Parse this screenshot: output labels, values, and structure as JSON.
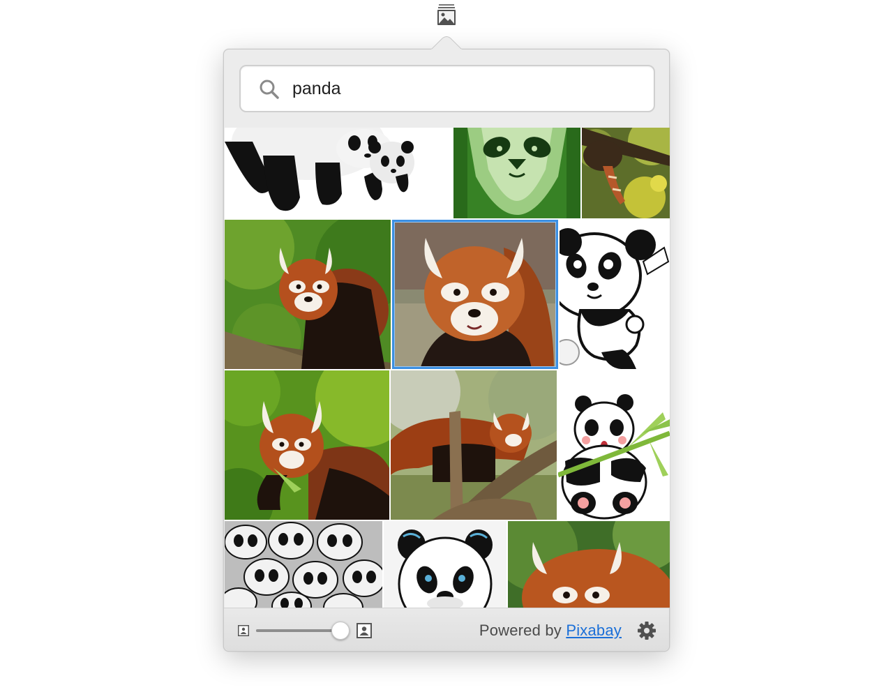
{
  "menubar": {
    "icon": "image-stack-icon"
  },
  "search": {
    "value": "panda",
    "icon": "search-icon"
  },
  "results": {
    "selected_index": 4,
    "images": [
      {
        "id": "cartoon-pandas-3d",
        "style": "3d-cartoon"
      },
      {
        "id": "panda-green-illustration",
        "style": "illustration"
      },
      {
        "id": "red-panda-in-tree",
        "style": "photo"
      },
      {
        "id": "red-panda-on-branch",
        "style": "photo"
      },
      {
        "id": "red-panda-portrait",
        "style": "photo"
      },
      {
        "id": "cartoon-panda-waving",
        "style": "cartoon"
      },
      {
        "id": "red-panda-eating-bamboo",
        "style": "photo"
      },
      {
        "id": "red-panda-climbing-log",
        "style": "photo"
      },
      {
        "id": "cartoon-panda-bamboo",
        "style": "cartoon"
      },
      {
        "id": "panda-pattern-grey",
        "style": "pattern"
      },
      {
        "id": "panda-face-logo",
        "style": "illustration"
      },
      {
        "id": "red-panda-closeup",
        "style": "photo"
      }
    ]
  },
  "footer": {
    "thumbnail_size": 0.9,
    "powered_prefix": "Powered by",
    "powered_link": "Pixabay",
    "settings_icon": "gear-icon"
  },
  "colors": {
    "accent": "#3b8fe2",
    "link": "#1a6fd8"
  }
}
